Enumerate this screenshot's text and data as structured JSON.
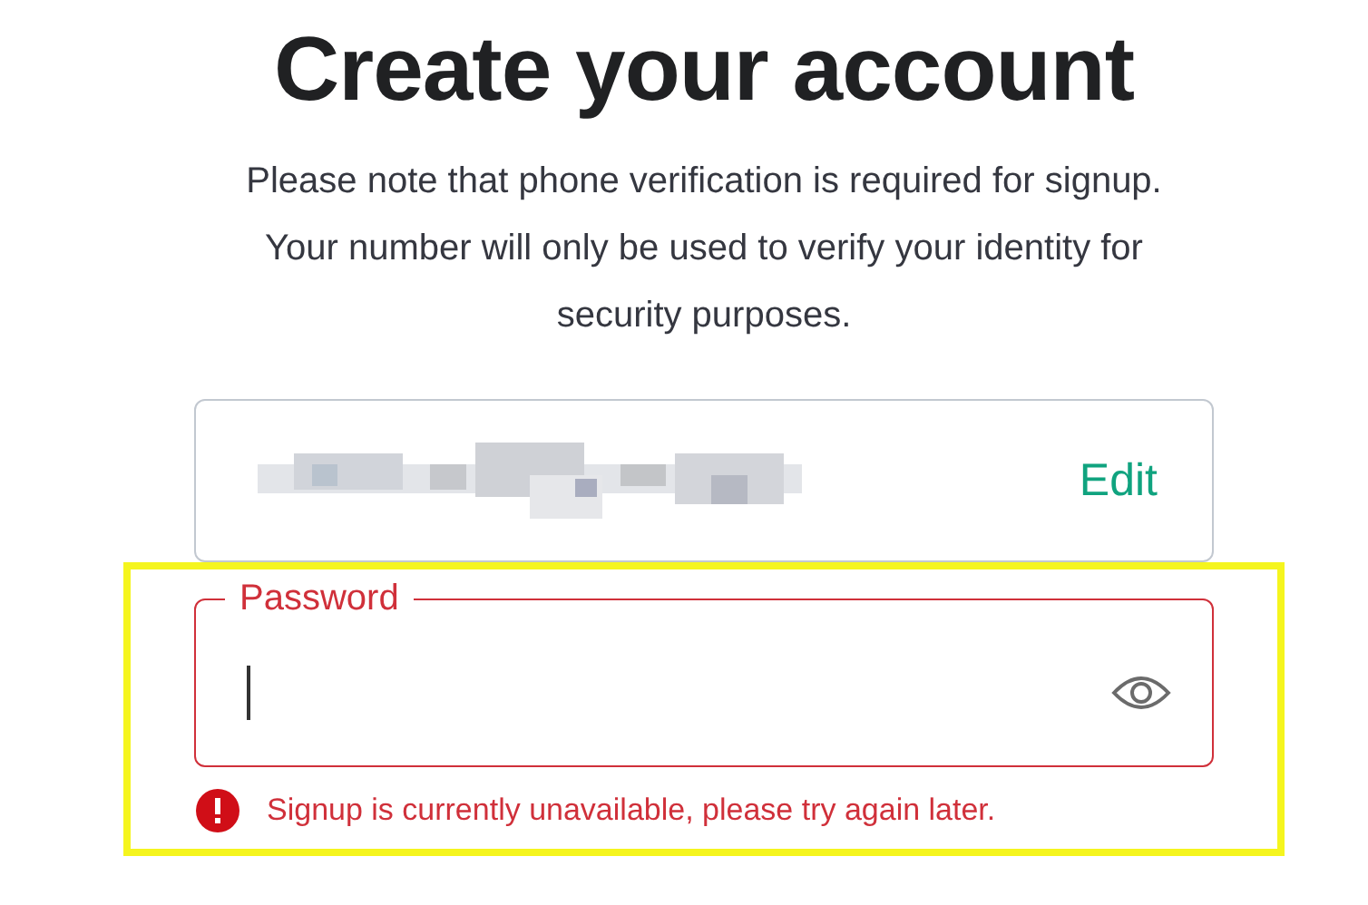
{
  "heading": "Create your account",
  "note": "Please note that phone verification is required for signup. Your number will only be used to verify your identity for security purposes.",
  "email_field": {
    "action": "Edit"
  },
  "password_field": {
    "label": "Password",
    "error": true
  },
  "error_message": "Signup is currently unavailable, please try again later."
}
